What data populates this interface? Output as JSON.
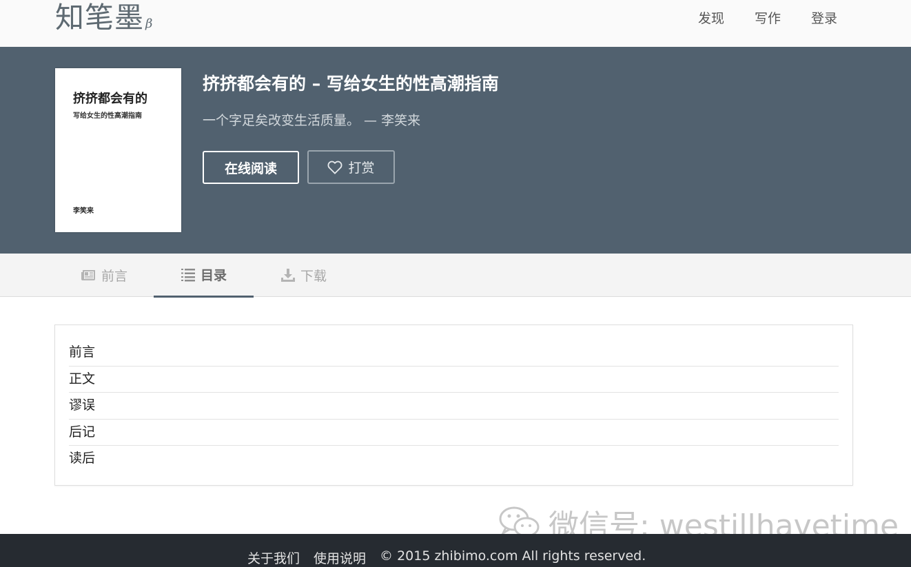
{
  "site": {
    "logo": "知笔墨",
    "logo_suffix": "β"
  },
  "nav": {
    "items": [
      "发现",
      "写作",
      "登录"
    ]
  },
  "book": {
    "cover_title": "挤挤都会有的",
    "cover_subtitle": "写给女生的性高潮指南",
    "cover_author": "李笑来",
    "title": "挤挤都会有的 – 写给女生的性高潮指南",
    "quote": "一个字足矣改变生活质量。 — 李笑来",
    "read_button": "在线阅读",
    "reward_button": "打赏"
  },
  "tabs": [
    {
      "label": "前言",
      "icon": "newspaper-icon",
      "active": false
    },
    {
      "label": "目录",
      "icon": "list-icon",
      "active": true
    },
    {
      "label": "下载",
      "icon": "download-icon",
      "active": false
    }
  ],
  "toc": {
    "items": [
      "前言",
      "正文",
      "谬误",
      "后记",
      "读后"
    ]
  },
  "watermark": {
    "text": "微信号: westillhavetime",
    "icon": "wechat-icon"
  },
  "footer": {
    "about": "关于我们",
    "guide": "使用说明",
    "copyright": "© 2015 zhibimo.com All rights reserved."
  },
  "colors": {
    "hero_bg": "#51616f",
    "footer_bg": "#262b31",
    "tab_active_underline": "#51616f"
  }
}
